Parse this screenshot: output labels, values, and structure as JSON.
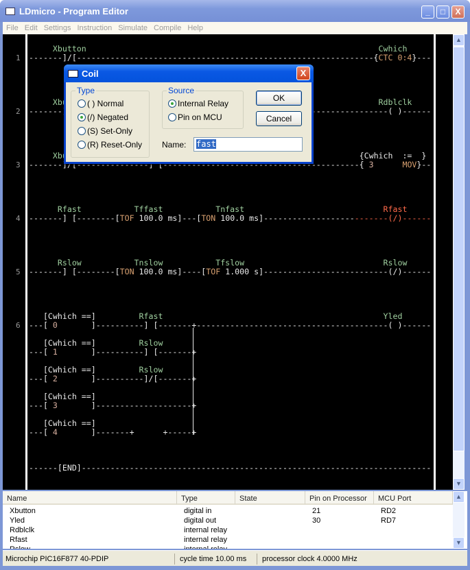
{
  "window": {
    "title": "LDmicro - Program Editor",
    "minimize": "_",
    "maximize": "□",
    "close": "X"
  },
  "menu": [
    "File",
    "Edit",
    "Settings",
    "Instruction",
    "Simulate",
    "Compile",
    "Help"
  ],
  "colors": {
    "wire": "#eaeaea",
    "label": "#9fcf9f",
    "keyword": "#d8a070",
    "value": "#d8b0a0",
    "selected": "#ff6a4a"
  },
  "ladder": {
    "rung_numbers": [
      "1",
      "2",
      "3",
      "4",
      "5",
      "6"
    ],
    "lines": [
      {
        "y": "r1l",
        "seg": [
          [
            "     Xbutton                                                             Cwhich",
            "label"
          ]
        ]
      },
      {
        "y": "r1w",
        "seg": [
          [
            "-------]/[--------------------------------------------------------------{",
            "wire"
          ],
          [
            "CTC 0:4",
            "keyword"
          ],
          [
            "}---",
            "wire"
          ]
        ]
      },
      {
        "y": "r2l",
        "seg": [
          [
            "     Xbutton                                                             Rdblclk",
            "label"
          ]
        ]
      },
      {
        "y": "r2w",
        "seg": [
          [
            "-------]/[-----------------------------------------------------------------( )------",
            "wire"
          ]
        ]
      },
      {
        "y": "r3l",
        "seg": [
          [
            "     Xbutton                                                         ",
            "label"
          ],
          [
            "{Cwhich  :=  }",
            "wire"
          ]
        ]
      },
      {
        "y": "r3w",
        "seg": [
          [
            "-------]/[---------------] [-----------------------------------------{ ",
            "wire"
          ],
          [
            "3",
            "value"
          ],
          [
            "      ",
            "wire"
          ],
          [
            "MOV",
            "keyword"
          ],
          [
            "}--",
            "wire"
          ]
        ]
      },
      {
        "y": "r4l",
        "seg": [
          [
            "      Rfast           Tffast           Tnfast                             ",
            "label"
          ],
          [
            "Rfast",
            "selected"
          ]
        ]
      },
      {
        "y": "r4w",
        "seg": [
          [
            "-------] [--------[",
            "wire"
          ],
          [
            "TOF",
            "keyword"
          ],
          [
            " 100.0 ms]---[",
            "wire"
          ],
          [
            "TON",
            "keyword"
          ],
          [
            " 100.0 ms]-------------------",
            "wire"
          ],
          [
            "-------(/)------",
            "selected"
          ]
        ]
      },
      {
        "y": "r5l",
        "seg": [
          [
            "      Rslow           Tnslow           Tfslow                             Rslow",
            "label"
          ]
        ]
      },
      {
        "y": "r5w",
        "seg": [
          [
            "-------] [--------[",
            "wire"
          ],
          [
            "TON",
            "keyword"
          ],
          [
            " 100.0 ms]----[",
            "wire"
          ],
          [
            "TOF",
            "keyword"
          ],
          [
            " 1.000 s]--------------------------(/)------",
            "wire"
          ]
        ]
      },
      {
        "y": "r6al",
        "seg": [
          [
            "   [Cwhich ==]",
            "wire"
          ],
          [
            "         Rfast                                              Yled",
            "label"
          ]
        ]
      },
      {
        "y": "r6aw",
        "seg": [
          [
            "---[ ",
            "wire"
          ],
          [
            "0",
            "value"
          ],
          [
            "       ]----------] [-------+----------------------------------------( )------",
            "wire"
          ]
        ]
      },
      {
        "y": "r6bl",
        "seg": [
          [
            "   [Cwhich ==]",
            "wire"
          ],
          [
            "         Rslow",
            "label"
          ]
        ]
      },
      {
        "y": "r6bw",
        "seg": [
          [
            "---[ ",
            "wire"
          ],
          [
            "1",
            "value"
          ],
          [
            "       ]----------] [-------+",
            "wire"
          ]
        ]
      },
      {
        "y": "r6cl",
        "seg": [
          [
            "   [Cwhich ==]",
            "wire"
          ],
          [
            "         Rslow",
            "label"
          ]
        ]
      },
      {
        "y": "r6cw",
        "seg": [
          [
            "---[ ",
            "wire"
          ],
          [
            "2",
            "value"
          ],
          [
            "       ]----------]/[-------+",
            "wire"
          ]
        ]
      },
      {
        "y": "r6dl",
        "seg": [
          [
            "   [Cwhich ==]",
            "wire"
          ]
        ]
      },
      {
        "y": "r6dw",
        "seg": [
          [
            "---[ ",
            "wire"
          ],
          [
            "3",
            "value"
          ],
          [
            "       ]--------------------+",
            "wire"
          ]
        ]
      },
      {
        "y": "r6el",
        "seg": [
          [
            "   [Cwhich ==]",
            "wire"
          ]
        ]
      },
      {
        "y": "r6ew",
        "seg": [
          [
            "---[ ",
            "wire"
          ],
          [
            "4",
            "value"
          ],
          [
            "       ]-------+      +-----+",
            "wire"
          ]
        ]
      },
      {
        "y": "endw",
        "seg": [
          [
            "------[END]-------------------------------------------------------------------------",
            "wire"
          ]
        ]
      }
    ]
  },
  "dialog": {
    "title": "Coil",
    "close": "X",
    "type_group": "Type",
    "type_options": [
      {
        "label": "( ) Normal",
        "checked": false
      },
      {
        "label": "(/) Negated",
        "checked": true
      },
      {
        "label": "(S) Set-Only",
        "checked": false
      },
      {
        "label": "(R) Reset-Only",
        "checked": false
      }
    ],
    "source_group": "Source",
    "source_options": [
      {
        "label": "Internal Relay",
        "checked": true
      },
      {
        "label": "Pin on MCU",
        "checked": false
      }
    ],
    "ok": "OK",
    "cancel": "Cancel",
    "name_label": "Name:",
    "name_value": "fast"
  },
  "io_list": {
    "headers": [
      "Name",
      "Type",
      "State",
      "Pin on Processor",
      "MCU Port"
    ],
    "rows": [
      [
        "Xbutton",
        "digital in",
        "",
        "21",
        "RD2"
      ],
      [
        "Yled",
        "digital out",
        "",
        "30",
        "RD7"
      ],
      [
        "Rdblclk",
        "internal relay",
        "",
        "",
        ""
      ],
      [
        "Rfast",
        "internal relay",
        "",
        "",
        ""
      ],
      [
        "Rslow",
        "internal relay",
        "",
        "",
        ""
      ]
    ]
  },
  "status": {
    "processor": "Microchip PIC16F877 40-PDIP",
    "cycle": "cycle time 10.00 ms",
    "clock": "processor clock 4.0000 MHz"
  }
}
